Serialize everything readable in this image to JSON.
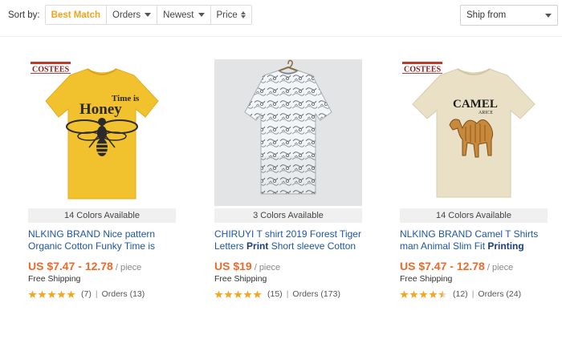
{
  "toolbar": {
    "sort_label": "Sort by:",
    "options": [
      "Best Match",
      "Orders",
      "Newest",
      "Price"
    ],
    "ship_from": "Ship from"
  },
  "products": [
    {
      "brand_badge": "COSTEES",
      "shirt_text_1": "Time is",
      "shirt_text_2": "Honey",
      "colors": "14 Colors Available",
      "title_plain": "NLKING BRAND Nice pattern Organic Cotton Funky Time is",
      "price": "US $7.47 - 12.78",
      "unit": "/ piece",
      "shipping": "Free Shipping",
      "rating": 5,
      "reviews": "(7)",
      "orders": "Orders (13)"
    },
    {
      "colors": "3 Colors Available",
      "title_before": "CHIRUYI T shirt 2019 Forest Tiger Letters ",
      "title_bold": "Print",
      "title_after": " Short sleeve Cotton",
      "price": "US $19",
      "unit": "/ piece",
      "shipping": "Free Shipping",
      "rating": 5,
      "reviews": "(15)",
      "orders": "Orders (173)"
    },
    {
      "brand_badge": "COSTEES",
      "shirt_text_1": "CAMEL",
      "shirt_text_2": "ARICE",
      "colors": "14 Colors Available",
      "title_before": "NLKING BRAND Camel T Shirts man Animal Slim Fit ",
      "title_bold": "Printing",
      "price": "US $7.47 - 12.78",
      "unit": "/ piece",
      "shipping": "Free Shipping",
      "rating": 4.5,
      "reviews": "(12)",
      "orders": "Orders (24)"
    }
  ],
  "icons": {
    "sort_caret": "chevron-down-icon",
    "price_sort": "sort-updown-icon",
    "ship_caret": "chevron-down-icon",
    "rating": "star-icon"
  },
  "colors": {
    "accent": "#f0a41e",
    "price": "#ee6a2c",
    "link": "#1d56a3",
    "star": "#f5a623",
    "shirt_yellow": "#f2c12e",
    "shirt_beige": "#e9e0c5"
  }
}
